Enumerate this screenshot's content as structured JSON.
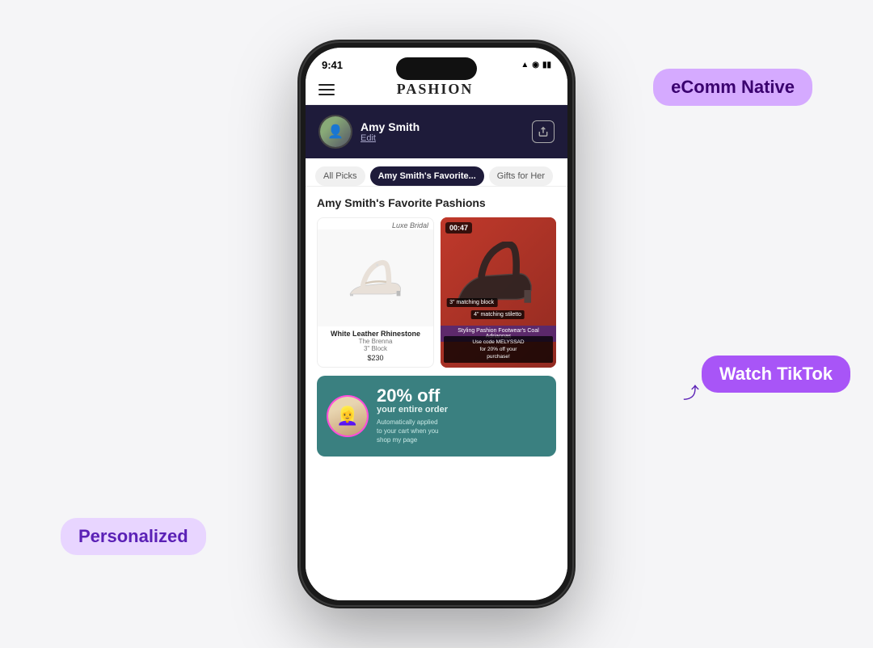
{
  "scene": {
    "background": "#f5f5f7"
  },
  "tooltips": {
    "ecomm": "eComm Native",
    "tiktok": "Watch TikTok",
    "personalized": "Personalized"
  },
  "phone": {
    "status": {
      "time": "9:41",
      "icons": "▲ ◉ ▮▮▮"
    },
    "navbar": {
      "logo": "PASHION"
    },
    "profile": {
      "name": "Amy Smith",
      "edit_label": "Edit",
      "share_icon": "↑"
    },
    "tabs": [
      {
        "label": "All Picks",
        "active": false
      },
      {
        "label": "Amy Smith's Favorite...",
        "active": true
      },
      {
        "label": "Gifts for Her",
        "active": false
      }
    ],
    "section_title": "Amy Smith's Favorite Pashions",
    "product": {
      "brand_label": "Luxe Bridal",
      "name": "White Leather Rhinestone",
      "sub": "The Brenna",
      "size": "3\" Block",
      "price": "$230"
    },
    "video": {
      "timer": "00:47",
      "tag1": "3\" matching block",
      "tag2": "4\" matching stiletto",
      "title": "Styling Pashion Footwear's Coal Adriannas",
      "promo": "Use code MELYSSAD\nfor 20% off your\npurchase!"
    },
    "banner": {
      "discount": "20% off",
      "subtitle": "your entire order",
      "description": "Automatically applied\nto your cart when you\nshop my page"
    }
  }
}
